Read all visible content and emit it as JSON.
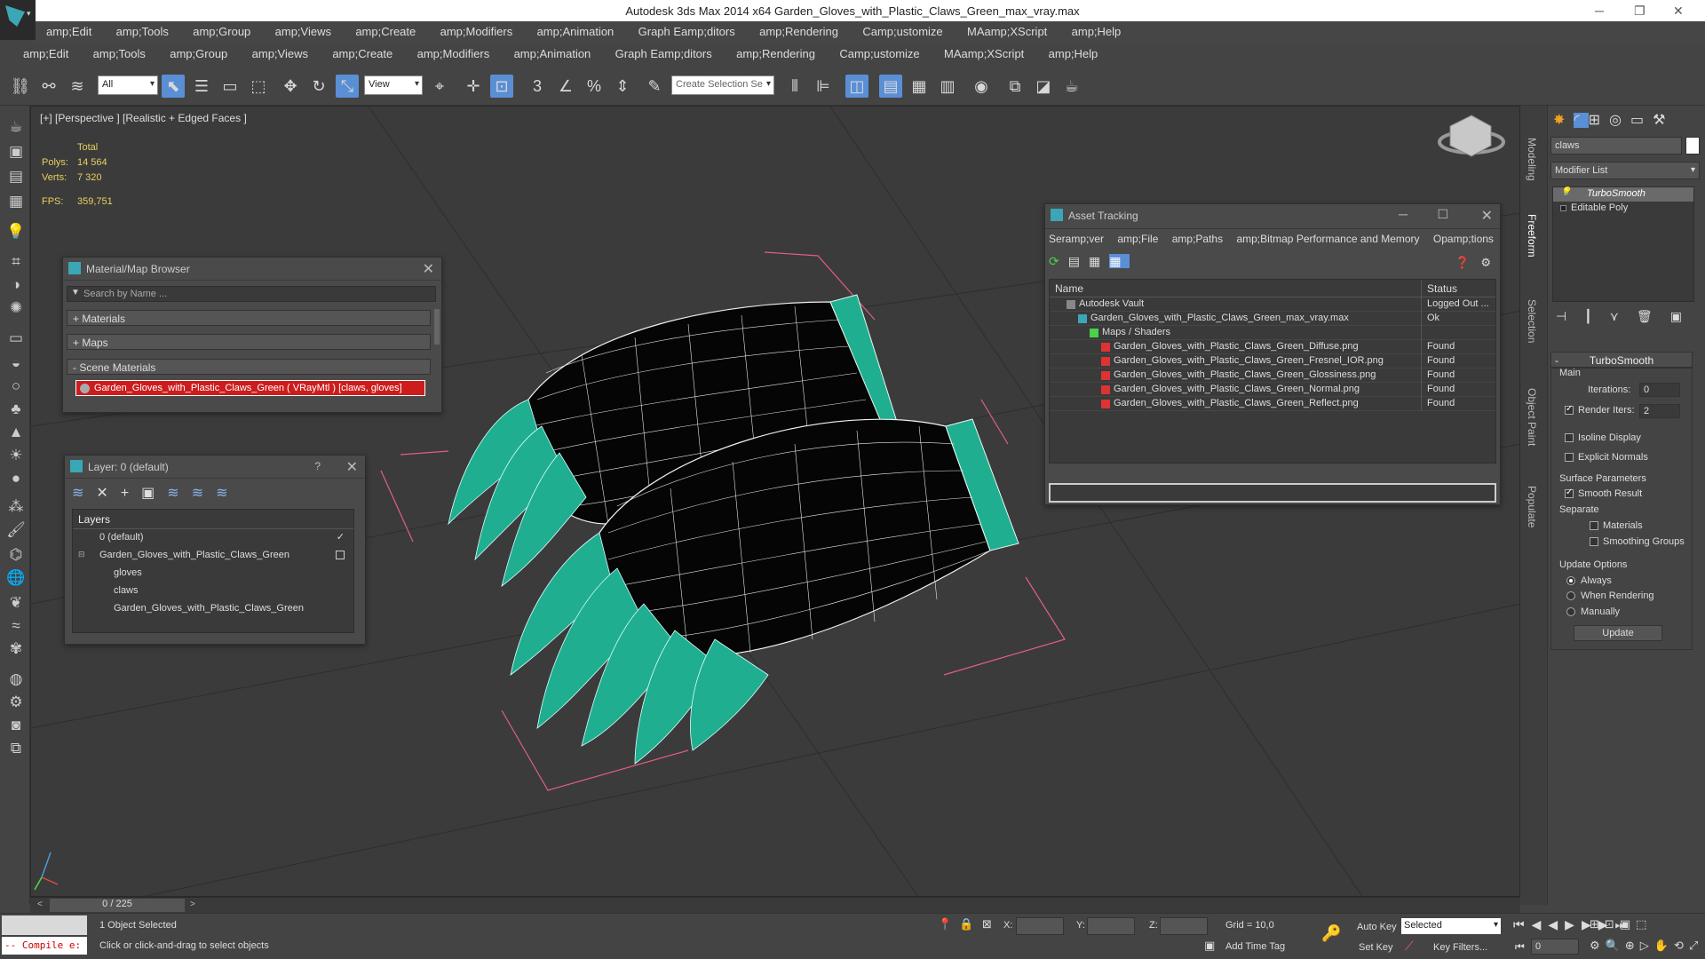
{
  "window": {
    "title": "Autodesk 3ds Max  2014 x64     Garden_Gloves_with_Plastic_Claws_Green_max_vray.max",
    "min": "─",
    "restore": "❐",
    "close": "✕"
  },
  "menu_top": [
    "amp;Edit",
    "amp;Tools",
    "amp;Group",
    "amp;Views",
    "amp;Create",
    "amp;Modifiers",
    "amp;Animation",
    "Graph Eamp;ditors",
    "amp;Rendering",
    "Camp;ustomize",
    "MAamp;XScript",
    "amp;Help"
  ],
  "menu_second": [
    "amp;Edit",
    "amp;Tools",
    "amp;Group",
    "amp;Views",
    "amp;Create",
    "amp;Modifiers",
    "amp;Animation",
    "Graph Eamp;ditors",
    "amp;Rendering",
    "Camp;ustomize",
    "MAamp;XScript",
    "amp;Help"
  ],
  "toolbar": {
    "filter_value": "All",
    "view_value": "View",
    "selection_set_placeholder": "Create Selection Se"
  },
  "viewport": {
    "label": "[+] [Perspective ] [Realistic + Edged Faces ]",
    "stats": {
      "total_label": "Total",
      "polys_label": "Polys:",
      "polys": "14 564",
      "verts_label": "Verts:",
      "verts": "7 320",
      "fps_label": "FPS:",
      "fps": "359,751"
    }
  },
  "material_browser": {
    "title": "Material/Map Browser",
    "search_placeholder": "Search by Name ...",
    "sections": [
      "+ Materials",
      "+ Maps",
      "- Scene Materials"
    ],
    "scene_material": "Garden_Gloves_with_Plastic_Claws_Green ( VRayMtl ) [claws, gloves]"
  },
  "layer_panel": {
    "title": "Layer: 0 (default)",
    "help": "?",
    "header": "Layers",
    "rows": [
      {
        "label": "0 (default)",
        "indent": 1
      },
      {
        "label": "Garden_Gloves_with_Plastic_Claws_Green",
        "indent": 1
      },
      {
        "label": "gloves",
        "indent": 2
      },
      {
        "label": "claws",
        "indent": 2
      },
      {
        "label": "Garden_Gloves_with_Plastic_Claws_Green",
        "indent": 2
      }
    ]
  },
  "asset_tracking": {
    "title": "Asset Tracking",
    "menu": [
      "Seramp;ver",
      "amp;File",
      "amp;Paths",
      "amp;Bitmap Performance and Memory",
      "Opamp;tions"
    ],
    "columns": [
      "Name",
      "Status"
    ],
    "rows": [
      {
        "name": "Autodesk Vault",
        "status": "Logged Out ...",
        "indent": 1,
        "icon": "vault-icon"
      },
      {
        "name": "Garden_Gloves_with_Plastic_Claws_Green_max_vray.max",
        "status": "Ok",
        "indent": 2,
        "icon": "max-file-icon"
      },
      {
        "name": "Maps / Shaders",
        "status": "",
        "indent": 3,
        "icon": "maps-icon"
      },
      {
        "name": "Garden_Gloves_with_Plastic_Claws_Green_Diffuse.png",
        "status": "Found",
        "indent": 4,
        "icon": "png-icon"
      },
      {
        "name": "Garden_Gloves_with_Plastic_Claws_Green_Fresnel_IOR.png",
        "status": "Found",
        "indent": 4,
        "icon": "png-icon"
      },
      {
        "name": "Garden_Gloves_with_Plastic_Claws_Green_Glossiness.png",
        "status": "Found",
        "indent": 4,
        "icon": "png-icon"
      },
      {
        "name": "Garden_Gloves_with_Plastic_Claws_Green_Normal.png",
        "status": "Found",
        "indent": 4,
        "icon": "png-icon"
      },
      {
        "name": "Garden_Gloves_with_Plastic_Claws_Green_Reflect.png",
        "status": "Found",
        "indent": 4,
        "icon": "png-icon"
      }
    ]
  },
  "command_panel": {
    "object_name": "claws",
    "modifier_list": "Modifier List",
    "stack": [
      "TurboSmooth",
      "Editable Poly"
    ],
    "turbosmooth": {
      "header": "TurboSmooth",
      "main": "Main",
      "iterations_label": "Iterations:",
      "iterations": "0",
      "render_iters_label": "Render Iters:",
      "render_iters": "2",
      "isoline": "Isoline Display",
      "explicit_normals": "Explicit Normals",
      "surface_params": "Surface Parameters",
      "smooth_result": "Smooth Result",
      "separate": "Separate",
      "materials": "Materials",
      "smoothing_groups": "Smoothing Groups",
      "update_options": "Update Options",
      "always": "Always",
      "when_rendering": "When Rendering",
      "manually": "Manually",
      "update_button": "Update"
    }
  },
  "side_tabs": [
    "Modeling",
    "Freeform",
    "Selection",
    "Object Paint",
    "Populate"
  ],
  "timeline": {
    "frame": "0 / 225"
  },
  "status": {
    "compile": "-- Compile e:",
    "selected": "1 Object Selected",
    "prompt": "Click or click-and-drag to select objects",
    "x_label": "X:",
    "y_label": "Y:",
    "z_label": "Z:",
    "grid": "Grid = 10,0",
    "auto_key": "Auto Key",
    "set_key": "Set Key",
    "key_mode": "Selected",
    "key_filters": "Key Filters...",
    "add_time_tag": "Add Time Tag",
    "frame_field": "0"
  },
  "colors": {
    "claw": "#1fae90",
    "accent": "#5a8fd6",
    "selection_red": "#cc1c1c",
    "stats_yellow": "#e8d060"
  }
}
